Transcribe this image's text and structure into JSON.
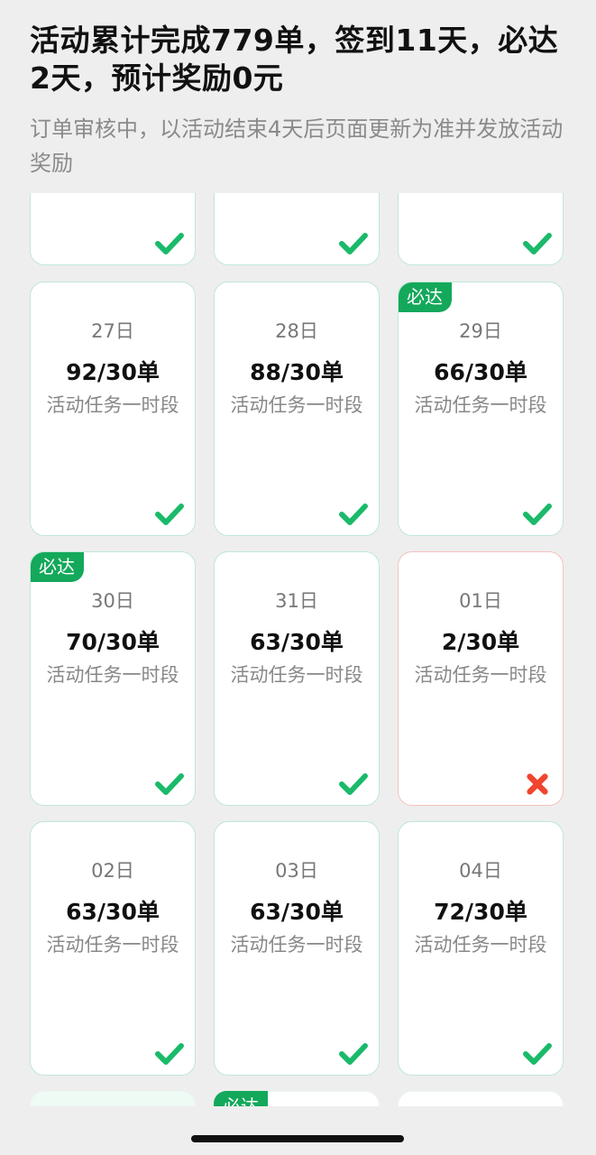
{
  "header": {
    "title": "活动累计完成779单，签到11天，必达2天，预计奖励0元",
    "subtitle": "订单审核中，以活动结束4天后页面更新为准并发放活动奖励"
  },
  "partial_top_row": [
    {
      "status": "success"
    },
    {
      "status": "success"
    },
    {
      "status": "success"
    }
  ],
  "days": [
    {
      "date": "27日",
      "count": "92/30单",
      "label": "活动任务一时段",
      "status": "success",
      "badge": ""
    },
    {
      "date": "28日",
      "count": "88/30单",
      "label": "活动任务一时段",
      "status": "success",
      "badge": ""
    },
    {
      "date": "29日",
      "count": "66/30单",
      "label": "活动任务一时段",
      "status": "success",
      "badge": "必达"
    },
    {
      "date": "30日",
      "count": "70/30单",
      "label": "活动任务一时段",
      "status": "success",
      "badge": "必达"
    },
    {
      "date": "31日",
      "count": "63/30单",
      "label": "活动任务一时段",
      "status": "success",
      "badge": ""
    },
    {
      "date": "01日",
      "count": "2/30单",
      "label": "活动任务一时段",
      "status": "fail",
      "badge": ""
    },
    {
      "date": "02日",
      "count": "63/30单",
      "label": "活动任务一时段",
      "status": "success",
      "badge": ""
    },
    {
      "date": "03日",
      "count": "63/30单",
      "label": "活动任务一时段",
      "status": "success",
      "badge": ""
    },
    {
      "date": "04日",
      "count": "72/30单",
      "label": "活动任务一时段",
      "status": "success",
      "badge": ""
    }
  ],
  "partial_bottom_row": [
    {
      "badge": ""
    },
    {
      "badge": "必达"
    },
    {
      "badge": ""
    }
  ],
  "colors": {
    "success": "#1aba6a",
    "fail": "#f0452f",
    "badge": "#14a85b"
  }
}
